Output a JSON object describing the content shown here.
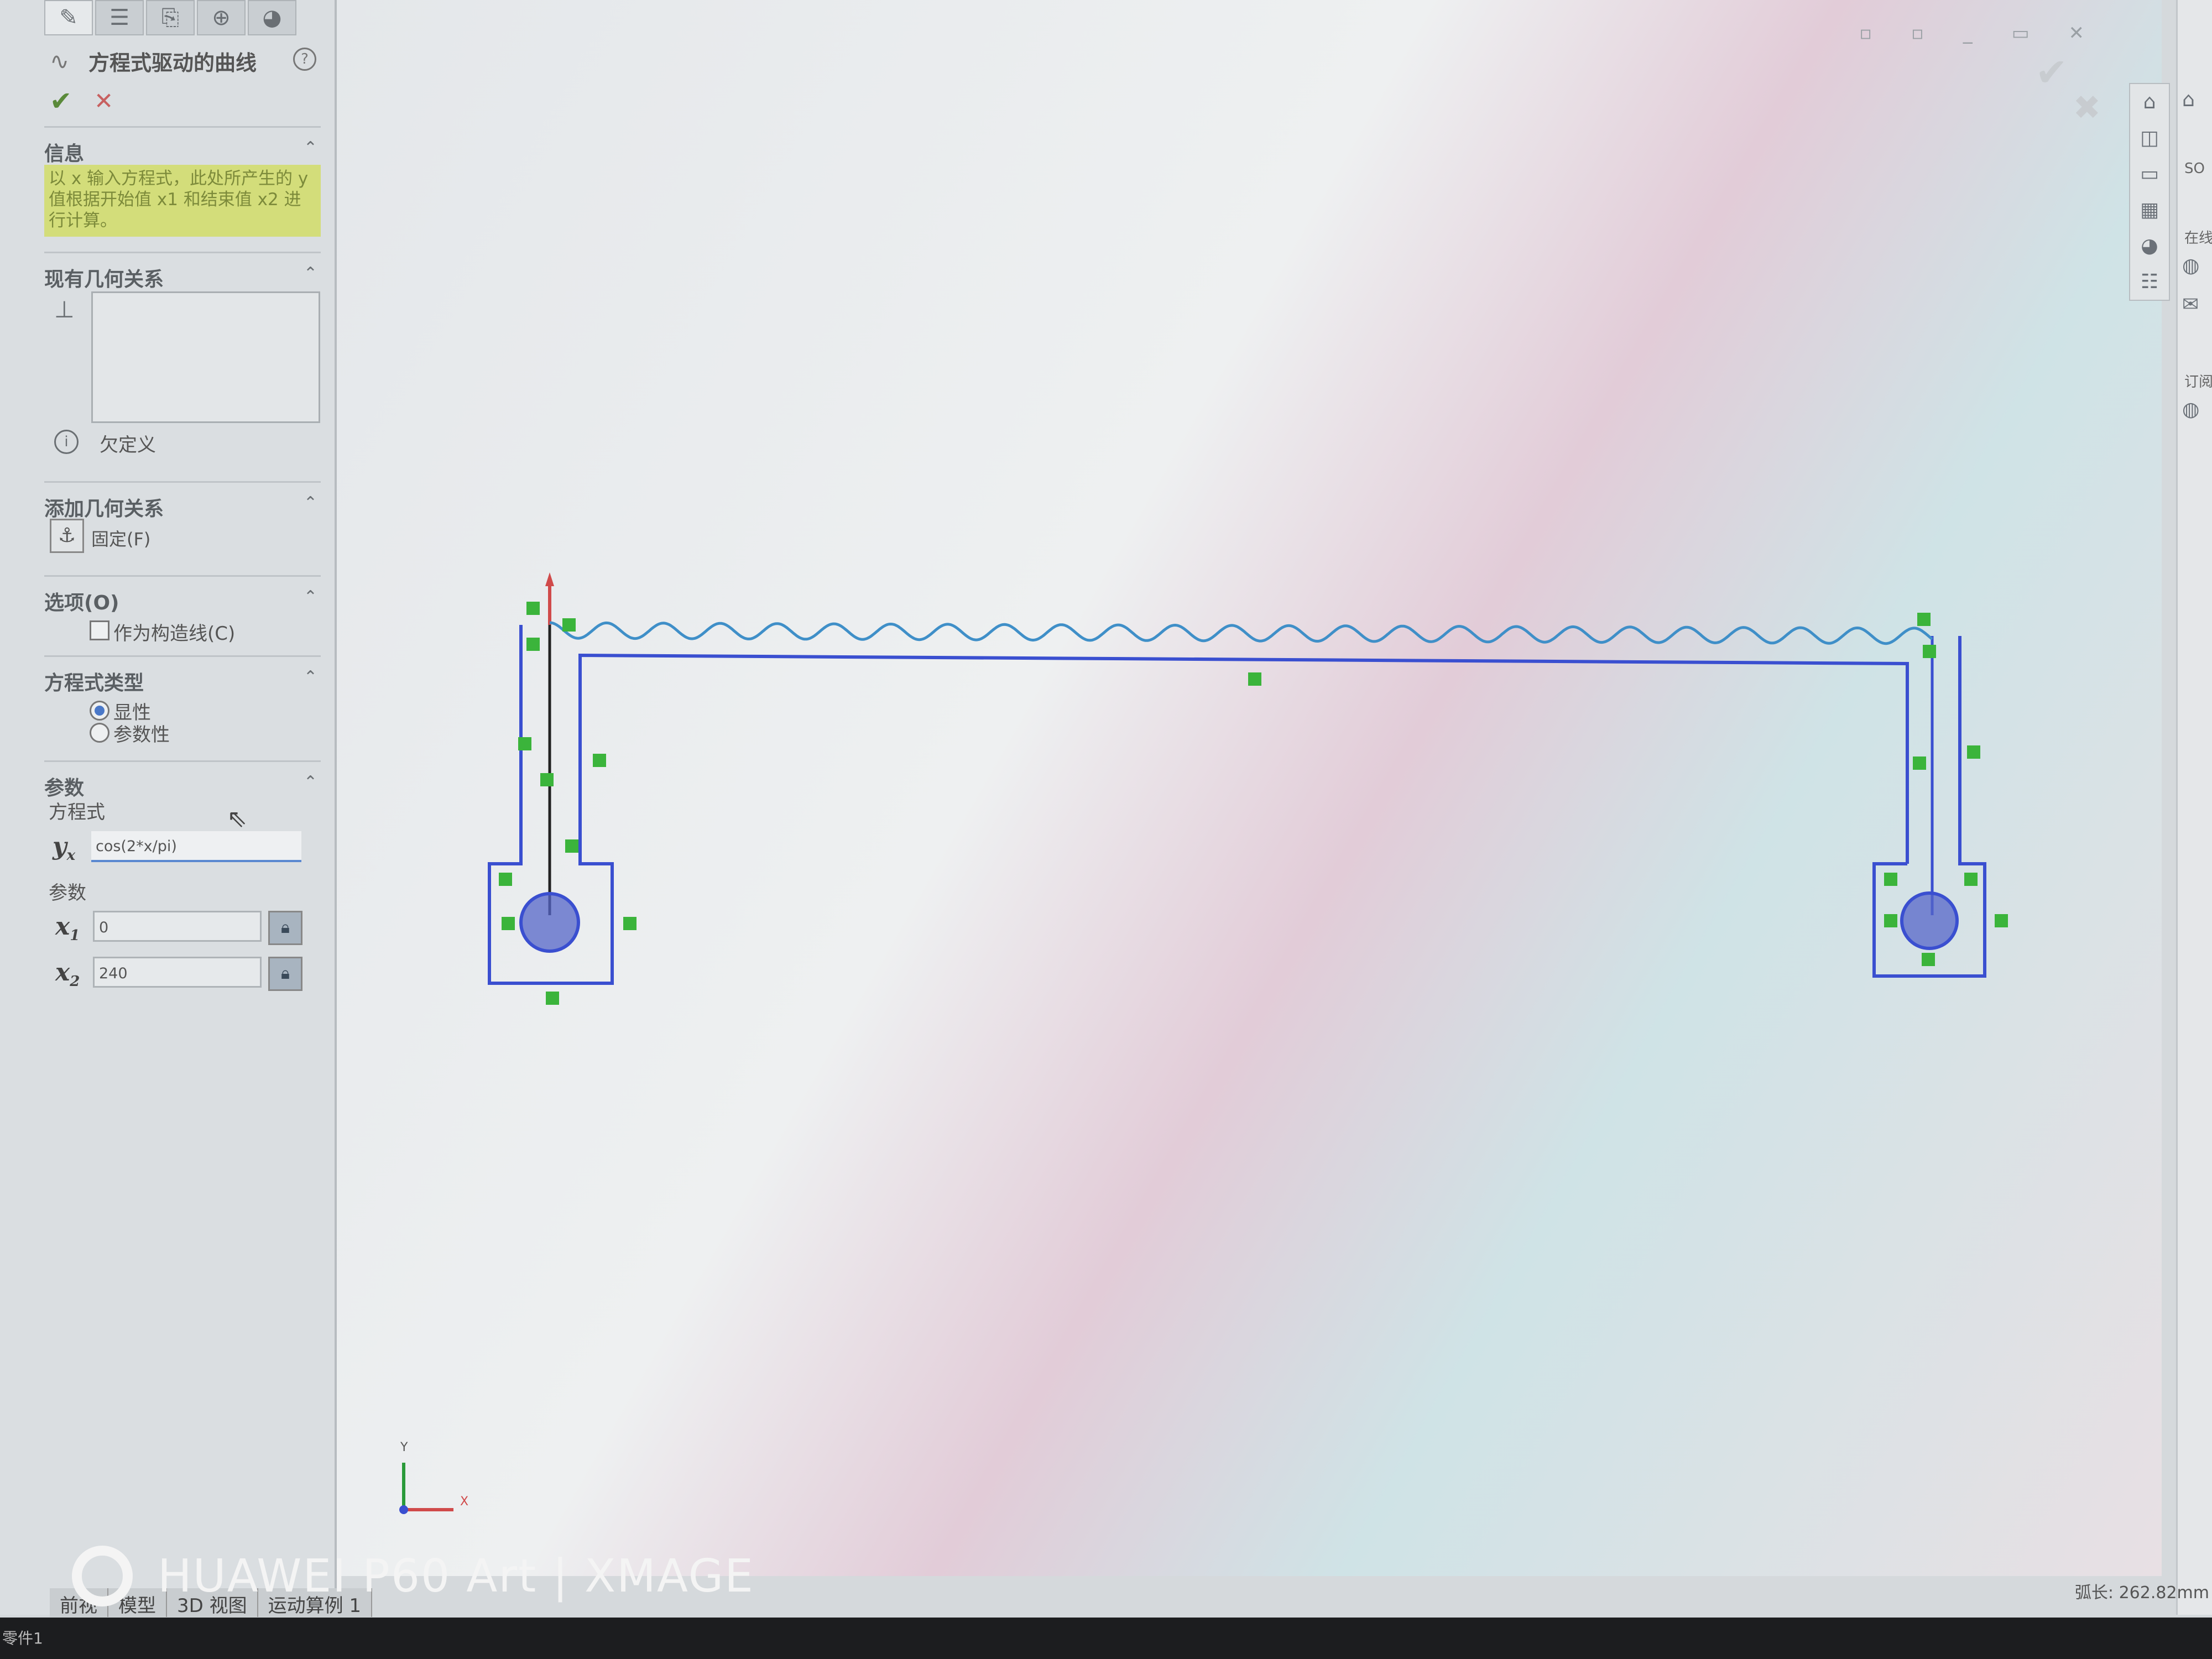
{
  "panel": {
    "title": "方程式驱动的曲线",
    "ok": "✔",
    "cancel": "✕",
    "info": {
      "heading": "信息",
      "text": "以 x 输入方程式，此处所产生的 y 值根据开始值 x1 和结束值 x2 进行计算。"
    },
    "existing_relations": {
      "heading": "现有几何关系",
      "status": "欠定义"
    },
    "add_relations": {
      "heading": "添加几何关系",
      "fix_label": "固定(F)"
    },
    "options": {
      "heading": "选项(O)",
      "construction_label": "作为构造线(C)",
      "construction_checked": false
    },
    "equation_type": {
      "heading": "方程式类型",
      "explicit": "显性",
      "parametric": "参数性",
      "selected": "显性"
    },
    "parameters": {
      "heading": "参数",
      "equation_label": "方程式",
      "yx_symbol": "y",
      "yx_sub": "x",
      "equation_value": "cos(2*x/pi)",
      "params_label": "参数",
      "x1_symbol": "x",
      "x1_sub": "1",
      "x1_value": "0",
      "x2_symbol": "x",
      "x2_sub": "2",
      "x2_value": "240"
    }
  },
  "bottom_tabs": [
    "模型",
    "3D 视图",
    "运动算例 1"
  ],
  "view_label": "前视",
  "arc_length": "弧长: 262.82mm",
  "status": "零件1",
  "watermark": "HUAWEI P60 Art | XMAGE",
  "triad": {
    "x": "X",
    "y": "Y"
  },
  "taskpane_text": [
    "SO",
    "在线",
    "订阅"
  ],
  "colors": {
    "sketch": "#3a4fd0",
    "curve": "#3f8fc8",
    "relation": "#3bb43b",
    "info_bg": "#d3dd7a"
  }
}
